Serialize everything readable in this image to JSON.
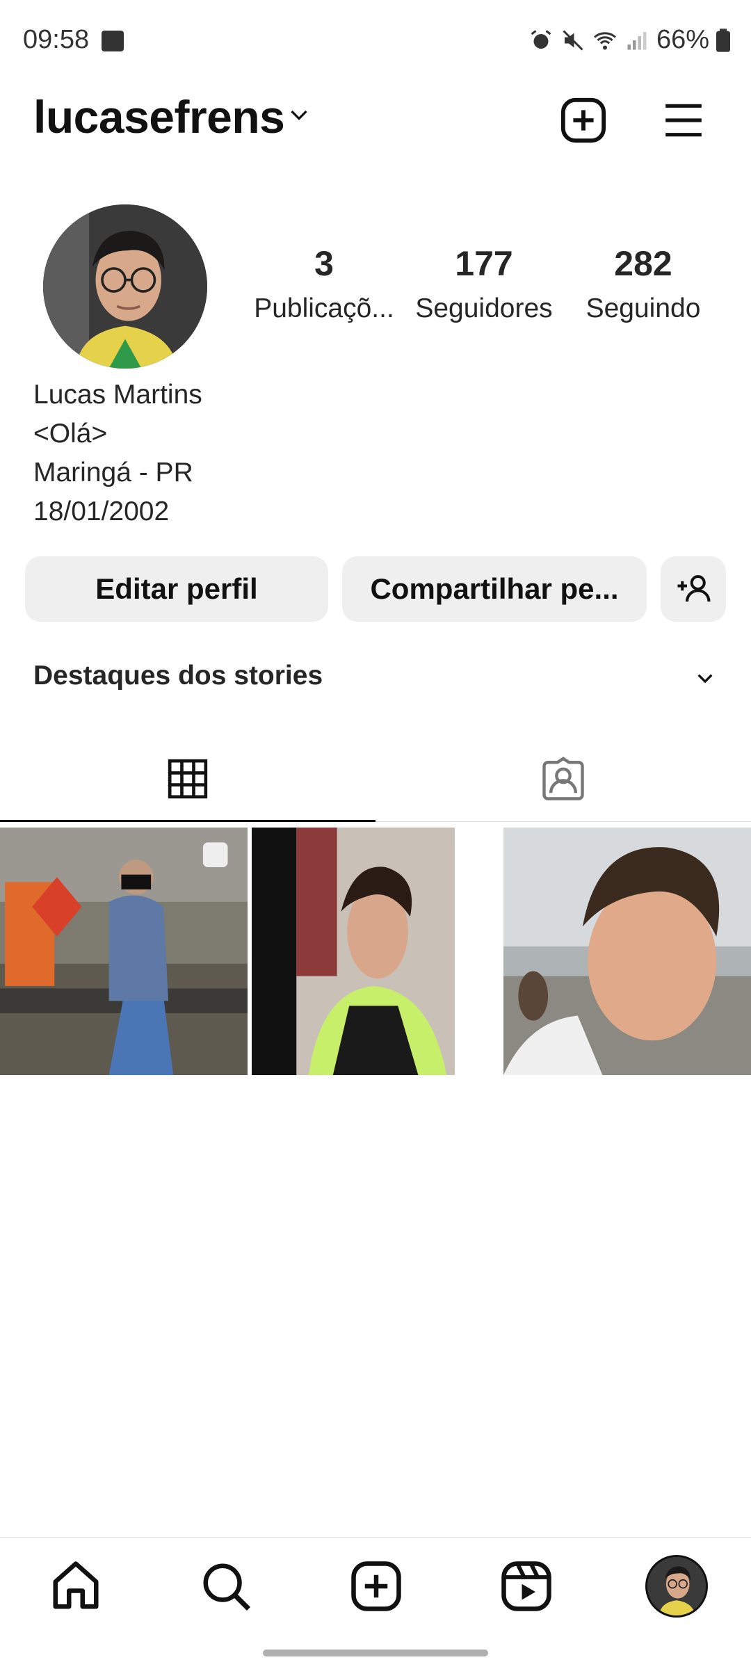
{
  "status_bar": {
    "time": "09:58",
    "battery": "66%",
    "icons": [
      "image-icon",
      "alarm-icon",
      "mute-icon",
      "wifi-icon",
      "signal-icon",
      "battery-icon"
    ]
  },
  "header": {
    "username": "lucasefrens",
    "icons": [
      "chevron-down-icon",
      "new-post-icon",
      "menu-icon"
    ]
  },
  "profile": {
    "stats": [
      {
        "value": "3",
        "label": "Publicaçõ..."
      },
      {
        "value": "177",
        "label": "Seguidores"
      },
      {
        "value": "282",
        "label": "Seguindo"
      }
    ],
    "bio": [
      "Lucas Martins",
      "<Olá>",
      "Maringá - PR",
      "18/01/2002"
    ]
  },
  "actions": {
    "edit_label": "Editar perfil",
    "share_label": "Compartilhar pe..."
  },
  "highlights": {
    "title": "Destaques dos stories"
  },
  "tabs": [
    {
      "name": "grid",
      "icon": "grid-icon",
      "active": true
    },
    {
      "name": "tagged",
      "icon": "tagged-icon",
      "active": false
    }
  ],
  "photos": [
    {
      "alt": "photo-1",
      "multi": true
    },
    {
      "alt": "photo-2",
      "multi": false
    },
    {
      "alt": "photo-3",
      "multi": false
    }
  ],
  "bottom_nav": [
    "home-icon",
    "search-icon",
    "create-icon",
    "reels-icon",
    "profile-avatar"
  ],
  "colors": {
    "text": "#262626",
    "button_bg": "#efefef",
    "divider": "#dbdbdb"
  }
}
